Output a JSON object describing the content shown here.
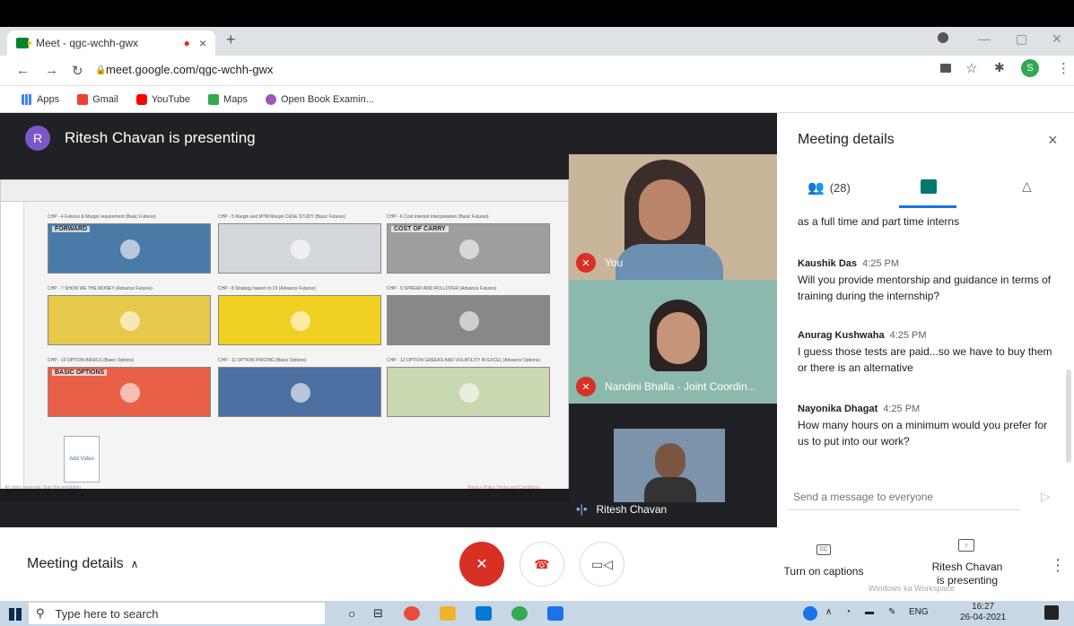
{
  "browser": {
    "tab_title": "Meet - qgc-wchh-gwx",
    "tab_recording": "●",
    "tab_close": "×",
    "new_tab": "+",
    "url": "meet.google.com/qgc-wchh-gwx",
    "profile_initial": "S",
    "bookmarks": [
      {
        "label": "Apps",
        "color": "#4285f4"
      },
      {
        "label": "Gmail",
        "color": "#ea4335"
      },
      {
        "label": "YouTube",
        "color": "#ff0000"
      },
      {
        "label": "Maps",
        "color": "#34a853"
      },
      {
        "label": "Open Book Examin...",
        "color": "#9b59b6"
      }
    ]
  },
  "meeting": {
    "presenter_initial": "R",
    "presenter_text": "Ritesh Chavan is presenting",
    "participants": [
      {
        "name": "You",
        "muted": true
      },
      {
        "name": "Nandini Bhalla - Joint Coordin...",
        "muted": true
      },
      {
        "name": "Ritesh Chavan",
        "muted": false
      }
    ]
  },
  "shared_screen": {
    "add_video_label": "Add Video",
    "footer_left": "All rights reserved. Start the revolution",
    "footer_right": "Privacy Policy    Terms and Conditions",
    "tiles": [
      {
        "label": "CHP - 4 Futures & Margin requirement (Basic Futures)",
        "banner": "FORWARD",
        "color": "#4a7aa8"
      },
      {
        "label": "CHP - 5 Margin and MTM Margin CASE STUDY (Basic Futures)",
        "banner": "",
        "color": "#d4d8dc"
      },
      {
        "label": "CHP - 6 Cost Interest Interpretation (Basic Futures)",
        "banner": "COST OF CARRY",
        "color": "#9e9e9e"
      },
      {
        "label": "CHP - 7 SHOW ME THE MONEY (Advance Futures)",
        "banner": "",
        "color": "#e6c94a"
      },
      {
        "label": "CHP - 8 Strategy based on OI (Advance Futures)",
        "banner": "",
        "color": "#f0d020"
      },
      {
        "label": "CHP - 9 SPREAD AND ROLLOVER (Advance Futures)",
        "banner": "",
        "color": "#888888"
      },
      {
        "label": "CHP - 10 OPTION BASICS (Basic Options)",
        "banner": "BASIC OPTIONS",
        "color": "#e86048"
      },
      {
        "label": "CHP - 11 OPTION PRICING (Basic Options)",
        "banner": "",
        "color": "#4a6fa0"
      },
      {
        "label": "CHP - 12 OPTION GREEKS AND VOLATILITY IN EXCEL (Advance Options)",
        "banner": "",
        "color": "#c9d8b0"
      }
    ]
  },
  "panel": {
    "title": "Meeting details",
    "close": "×",
    "people_count": "(28)",
    "partial_message": "as a full time and part time interns",
    "messages": [
      {
        "author": "Kaushik Das",
        "time": "4:25 PM",
        "text": "Will you provide mentorship and guidance in terms of training during the internship?"
      },
      {
        "author": "Anurag Kushwaha",
        "time": "4:25 PM",
        "text": "I guess those tests are paid...so we have to buy them or there is an alternative"
      },
      {
        "author": "Nayonika Dhagat",
        "time": "4:25 PM",
        "text": "How many hours on a minimum would you prefer for us to put into our work?"
      }
    ],
    "input_placeholder": "Send a message to everyone"
  },
  "bottom_bar": {
    "meeting_details": "Meeting details",
    "captions": "Turn on captions",
    "presenting_line1": "Ritesh Chavan",
    "presenting_line2": "is presenting"
  },
  "taskbar": {
    "search_placeholder": "Type here to search",
    "lang": "ENG",
    "time": "16:27",
    "date": "26-04-2021",
    "watermark": "Windows ka Workspace"
  },
  "colors": {
    "meet_bg": "#202124",
    "mic_off": "#d93025",
    "accent": "#1a73e8",
    "chat_active": "#00796b"
  }
}
